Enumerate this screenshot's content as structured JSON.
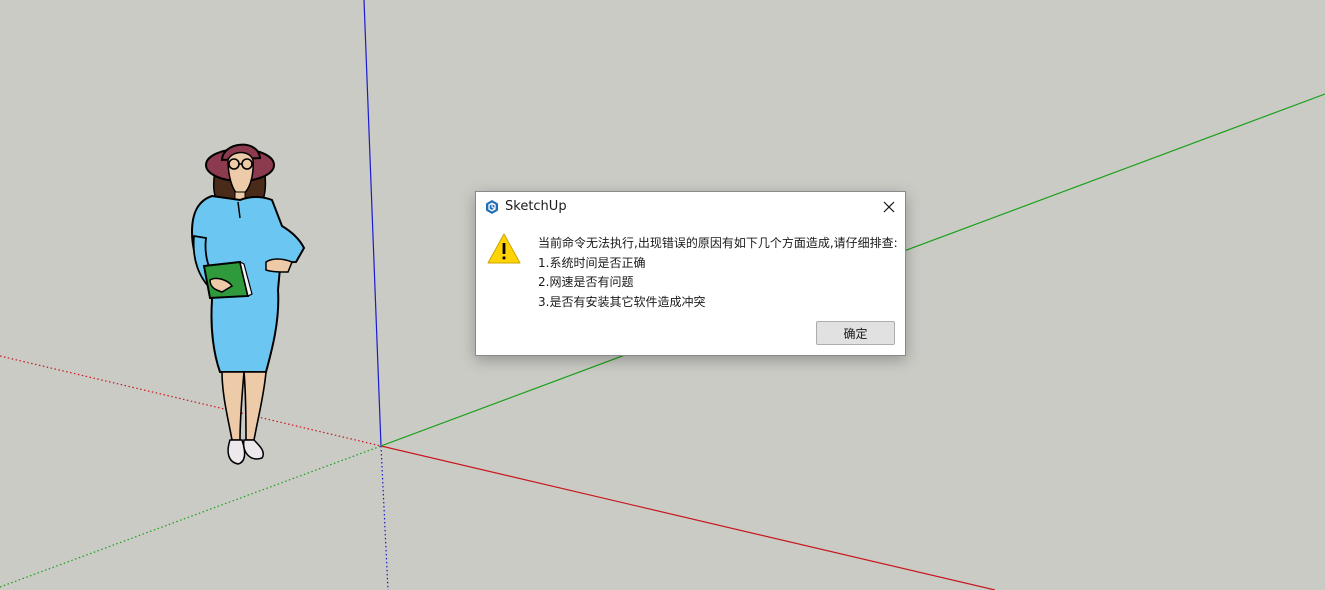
{
  "dialog": {
    "title": "SketchUp",
    "message_lines": [
      "当前命令无法执行,出现错误的原因有如下几个方面造成,请仔细排查:",
      "1.系统时间是否正确",
      "2.网速是否有问题",
      "3.是否有安装其它软件造成冲突"
    ],
    "ok_label": "确定"
  },
  "icons": {
    "app": "sketchup-logo-icon",
    "close": "close-icon",
    "warning": "warning-icon"
  },
  "colors": {
    "canvas_background": "#cbcbc6",
    "axis_red": "#c8161c",
    "axis_green": "#17a017",
    "axis_blue": "#1a1ad0",
    "warning_yellow": "#ffd400",
    "app_icon_blue": "#1f6fb5"
  }
}
